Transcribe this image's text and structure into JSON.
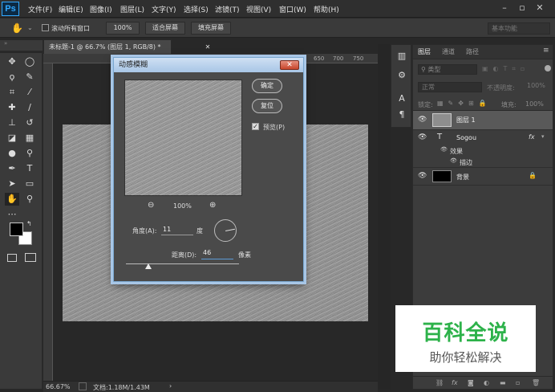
{
  "app": {
    "logo": "Ps"
  },
  "menu": [
    "文件(F)",
    "编辑(E)",
    "图像(I)",
    "图层(L)",
    "文字(Y)",
    "选择(S)",
    "滤镜(T)",
    "视图(V)",
    "窗口(W)",
    "帮助(H)"
  ],
  "options": {
    "scroll_all_label": "滚动所有窗口",
    "zoom_pct": "100%",
    "fit_screen": "适合屏幕",
    "fill_screen": "填充屏幕",
    "workspace": "基本功能"
  },
  "document": {
    "tab_title": "未标题-1 @ 66.7% (图层 1, RGB/8) *",
    "zoom": "66.67%",
    "doc_size": "文档:1.18M/1.43M",
    "ruler_marks": [
      "650",
      "700",
      "750"
    ]
  },
  "dialog": {
    "title": "动感模糊",
    "ok": "确定",
    "reset": "复位",
    "preview_label": "预览(P)",
    "zoom": "100%",
    "angle_label": "角度(A):",
    "angle_value": "11",
    "angle_unit": "度",
    "distance_label": "距离(D):",
    "distance_value": "46",
    "distance_unit": "像素",
    "distance_fraction": 0.2
  },
  "panel": {
    "tabs": [
      "图层",
      "通道",
      "路径"
    ],
    "kind_label": "类型",
    "blend_mode": "正常",
    "opacity_label": "不透明度:",
    "opacity_value": "100%",
    "lock_label": "锁定:",
    "fill_label": "填充:",
    "fill_value": "100%",
    "layers": [
      {
        "name": "图层 1"
      },
      {
        "name": "Sogou",
        "fx": "fx",
        "effects_label": "效果",
        "effect": "描边"
      },
      {
        "name": "背景"
      }
    ]
  },
  "watermark": {
    "title": "百科全说",
    "subtitle": "助你轻松解决"
  },
  "colors": {
    "accent": "#31a8ff",
    "watermark_green": "#2db24a"
  }
}
